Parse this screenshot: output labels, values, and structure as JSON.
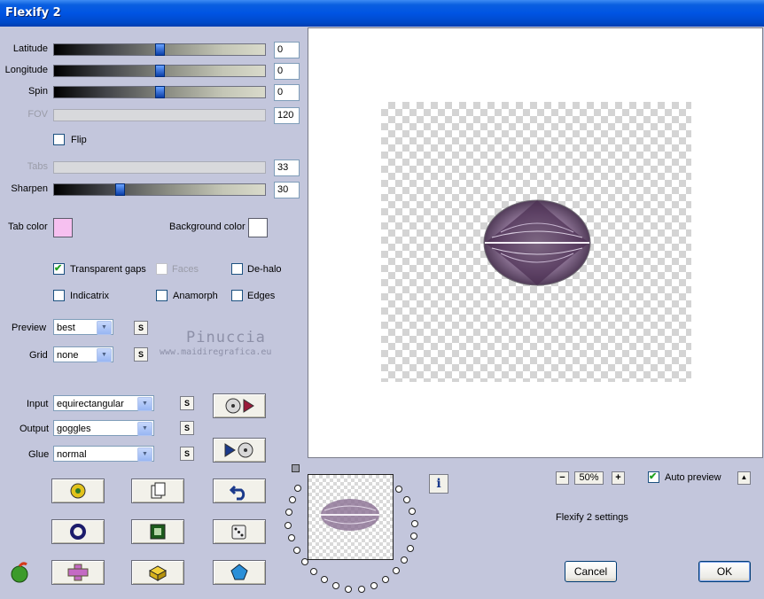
{
  "window": {
    "title": "Flexify 2"
  },
  "sliders": [
    {
      "label": "Latitude",
      "value": "0",
      "level": 0.5,
      "enabled": true
    },
    {
      "label": "Longitude",
      "value": "0",
      "level": 0.5,
      "enabled": true
    },
    {
      "label": "Spin",
      "value": "0",
      "level": 0.5,
      "enabled": true
    },
    {
      "label": "FOV",
      "value": "120",
      "enabled": false
    },
    {
      "label": "Tabs",
      "value": "33",
      "enabled": false
    },
    {
      "label": "Sharpen",
      "value": "30",
      "level": 0.3,
      "enabled": true
    }
  ],
  "flip": {
    "label": "Flip",
    "checked": false
  },
  "colors": {
    "tab_label": "Tab color",
    "tab_value": "#f6c0f0",
    "background_label": "Background color",
    "background_value": "#ffffff"
  },
  "checkboxes": {
    "transparent_gaps": {
      "label": "Transparent gaps",
      "checked": true
    },
    "faces": {
      "label": "Faces",
      "checked": false,
      "enabled": false
    },
    "de_halo": {
      "label": "De-halo",
      "checked": false
    },
    "indicatrix": {
      "label": "Indicatrix",
      "checked": false
    },
    "anamorph": {
      "label": "Anamorph",
      "checked": false
    },
    "edges": {
      "label": "Edges",
      "checked": false
    }
  },
  "preview": {
    "label": "Preview",
    "value": "best"
  },
  "grid": {
    "label": "Grid",
    "value": "none"
  },
  "watermark": {
    "name": "Pinuccia",
    "url": "www.maidiregrafica.eu"
  },
  "input": {
    "label": "Input",
    "value": "equirectangular"
  },
  "output": {
    "label": "Output",
    "value": "goggles"
  },
  "glue": {
    "label": "Glue",
    "value": "normal"
  },
  "s_button_label": "S",
  "zoom": {
    "value": "50%",
    "minus": "−",
    "plus": "+"
  },
  "auto_preview": {
    "label": "Auto preview",
    "checked": true,
    "arrow": "▲"
  },
  "settings_label": "Flexify 2 settings",
  "buttons": {
    "cancel": "Cancel",
    "ok": "OK",
    "info": "i"
  },
  "accent": "#0054e3"
}
